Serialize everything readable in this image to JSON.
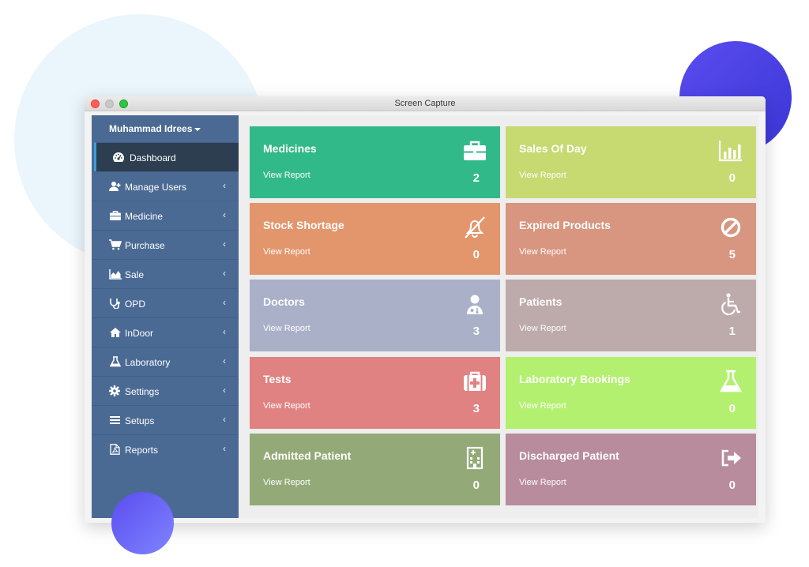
{
  "window": {
    "title": "Screen Capture"
  },
  "sidebar": {
    "user_name": "Muhammad Idrees",
    "items": [
      {
        "label": "Dashboard",
        "icon": "dashboard-icon"
      },
      {
        "label": "Manage Users",
        "icon": "add-user-icon"
      },
      {
        "label": "Medicine",
        "icon": "briefcase-icon"
      },
      {
        "label": "Purchase",
        "icon": "cart-icon"
      },
      {
        "label": "Sale",
        "icon": "area-chart-icon"
      },
      {
        "label": "OPD",
        "icon": "stethoscope-icon"
      },
      {
        "label": "InDoor",
        "icon": "home-icon"
      },
      {
        "label": "Laboratory",
        "icon": "flask-icon"
      },
      {
        "label": "Settings",
        "icon": "gear-icon"
      },
      {
        "label": "Setups",
        "icon": "list-icon"
      },
      {
        "label": "Reports",
        "icon": "pdf-file-icon"
      }
    ],
    "chevron": "‹"
  },
  "cards": [
    {
      "title": "Medicines",
      "link": "View Report",
      "count": "2",
      "icon": "briefcase-icon",
      "color": "#32b989"
    },
    {
      "title": "Sales Of Day",
      "link": "View Report",
      "count": "0",
      "icon": "bar-chart-icon",
      "color": "#c7d971"
    },
    {
      "title": "Stock Shortage",
      "link": "View Report",
      "count": "0",
      "icon": "bell-slash-icon",
      "color": "#e3956c"
    },
    {
      "title": "Expired Products",
      "link": "View Report",
      "count": "5",
      "icon": "ban-icon",
      "color": "#d8957f"
    },
    {
      "title": "Doctors",
      "link": "View Report",
      "count": "3",
      "icon": "user-doctor-icon",
      "color": "#a9b0c8"
    },
    {
      "title": "Patients",
      "link": "View Report",
      "count": "1",
      "icon": "wheelchair-icon",
      "color": "#bdaaaa"
    },
    {
      "title": "Tests",
      "link": "View Report",
      "count": "3",
      "icon": "medkit-icon",
      "color": "#e08282"
    },
    {
      "title": "Laboratory Bookings",
      "link": "View Report",
      "count": "0",
      "icon": "flask-icon",
      "color": "#b3f06f"
    },
    {
      "title": "Admitted Patient",
      "link": "View Report",
      "count": "0",
      "icon": "hospital-icon",
      "color": "#93aa78"
    },
    {
      "title": "Discharged Patient",
      "link": "View Report",
      "count": "0",
      "icon": "sign-out-icon",
      "color": "#b88b9d"
    }
  ]
}
